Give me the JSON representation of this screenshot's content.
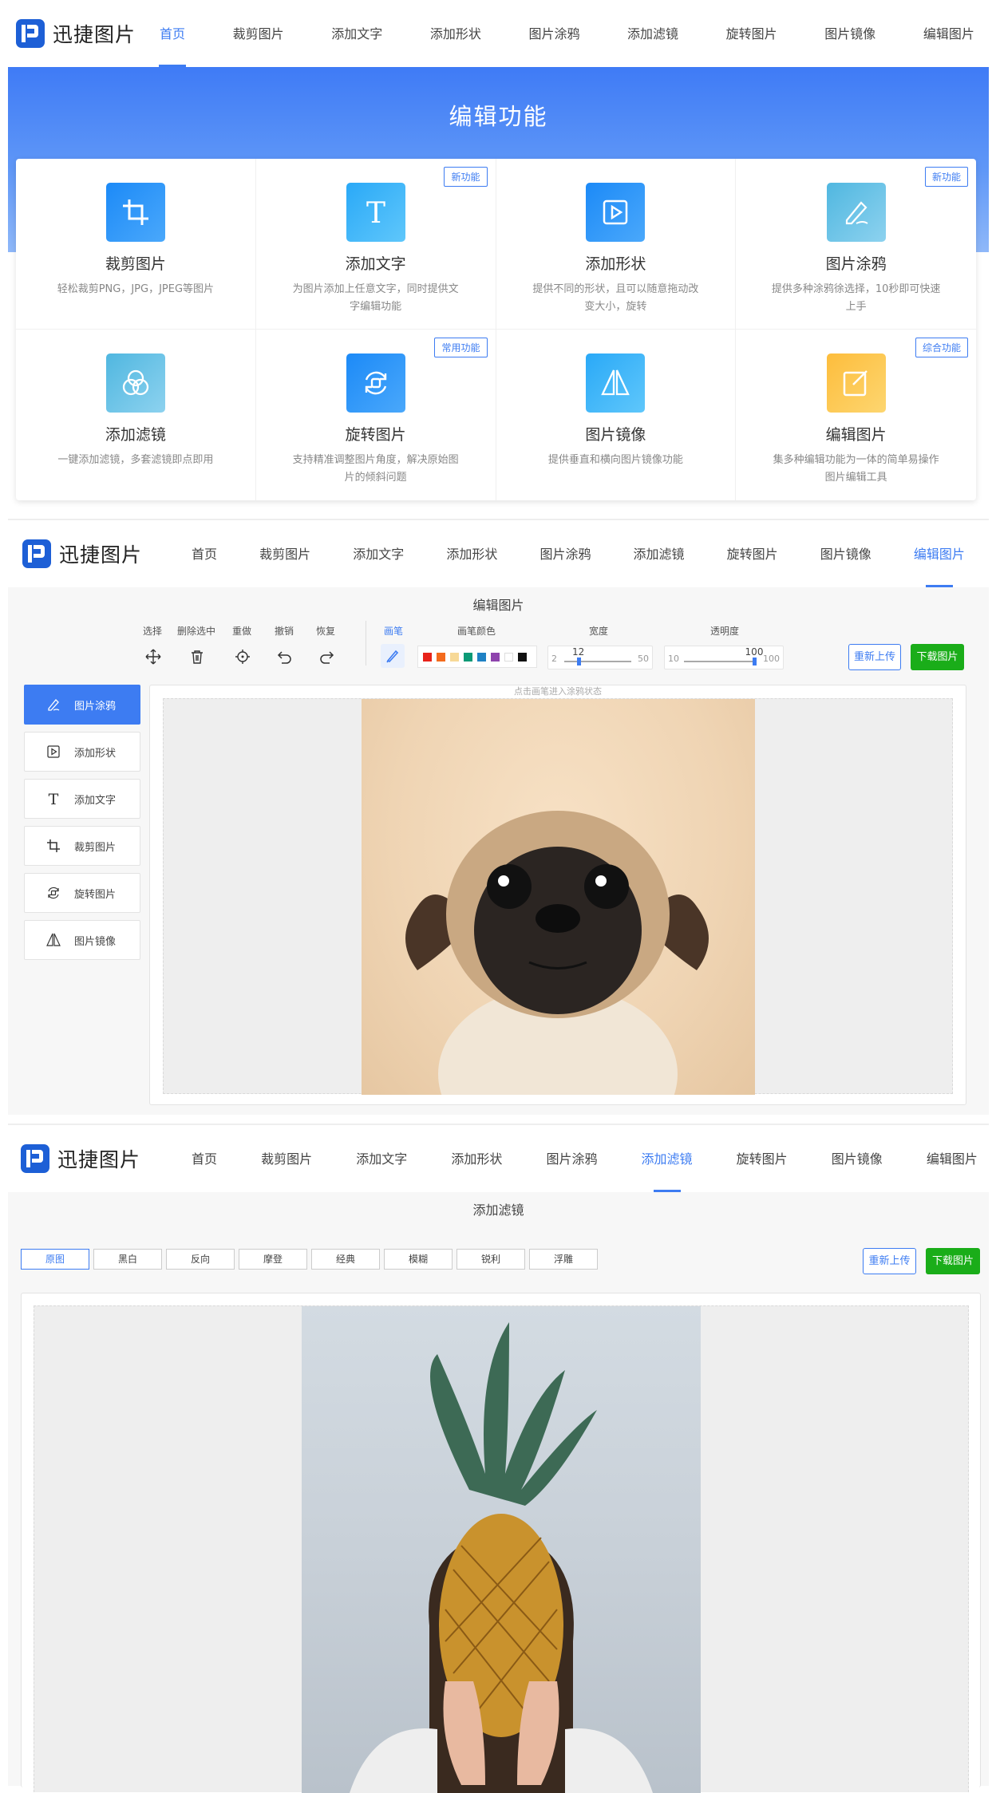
{
  "brand": {
    "name": "迅捷图片",
    "accent": "#3d7cf2",
    "green": "#1aad19"
  },
  "nav_items": [
    "首页",
    "裁剪图片",
    "添加文字",
    "添加形状",
    "图片涂鸦",
    "添加滤镜",
    "旋转图片",
    "图片镜像",
    "编辑图片"
  ],
  "panel1": {
    "active_nav": "首页",
    "hero_title": "编辑功能",
    "cards": [
      {
        "icon": "crop-icon",
        "title": "裁剪图片",
        "desc": "轻松裁剪PNG，JPG，JPEG等图片",
        "badge": ""
      },
      {
        "icon": "text-icon",
        "title": "添加文字",
        "desc": "为图片添加上任意文字，同时提供文字编辑功能",
        "badge": "新功能"
      },
      {
        "icon": "shape-icon",
        "title": "添加形状",
        "desc": "提供不同的形状，且可以随意拖动改变大小，旋转",
        "badge": ""
      },
      {
        "icon": "brush-icon",
        "title": "图片涂鸦",
        "desc": "提供多种涂鸦徐选择，10秒即可快速上手",
        "badge": "新功能"
      },
      {
        "icon": "filter-icon",
        "title": "添加滤镜",
        "desc": "一键添加滤镜，多套滤镜即点即用",
        "badge": ""
      },
      {
        "icon": "rotate-icon",
        "title": "旋转图片",
        "desc": "支持精准调整图片角度，解决原始图片的倾斜问题",
        "badge": "常用功能"
      },
      {
        "icon": "mirror-icon",
        "title": "图片镜像",
        "desc": "提供垂直和横向图片镜像功能",
        "badge": ""
      },
      {
        "icon": "edit-icon",
        "title": "编辑图片",
        "desc": "集多种编辑功能为一体的简单易操作图片编辑工具",
        "badge": "综合功能"
      }
    ]
  },
  "panel2": {
    "active_nav": "编辑图片",
    "title": "编辑图片",
    "tools": [
      {
        "label": "选择",
        "icon": "move-icon"
      },
      {
        "label": "删除选中",
        "icon": "trash-icon"
      },
      {
        "label": "重做",
        "icon": "target-icon"
      },
      {
        "label": "撤销",
        "icon": "undo-icon"
      },
      {
        "label": "恢复",
        "icon": "redo-icon"
      }
    ],
    "brush_label": "画笔",
    "brush_color_label": "画笔颜色",
    "colors": [
      "#e8231a",
      "#f46b1d",
      "#f7d997",
      "#0c9a76",
      "#1f81c4",
      "#8e44ad",
      "#ffffff",
      "#111111"
    ],
    "width": {
      "label": "宽度",
      "min": "2",
      "max": "50",
      "value": "12",
      "fraction": 0.21
    },
    "opacity": {
      "label": "透明度",
      "min": "10",
      "max": "100",
      "value": "100",
      "fraction": 1.0
    },
    "reupload": "重新上传",
    "download": "下载图片",
    "hint": "点击画笔进入涂鸦状态",
    "sidebar": [
      {
        "icon": "pen-icon",
        "label": "图片涂鸦",
        "active": true
      },
      {
        "icon": "shape-icon",
        "label": "添加形状",
        "active": false
      },
      {
        "icon": "text-icon",
        "label": "添加文字",
        "active": false
      },
      {
        "icon": "crop-icon",
        "label": "裁剪图片",
        "active": false
      },
      {
        "icon": "rotate-icon",
        "label": "旋转图片",
        "active": false
      },
      {
        "icon": "mirror-icon",
        "label": "图片镜像",
        "active": false
      }
    ]
  },
  "panel3": {
    "active_nav": "添加滤镜",
    "title": "添加滤镜",
    "filters": [
      "原图",
      "黑白",
      "反向",
      "摩登",
      "经典",
      "模糊",
      "锐利",
      "浮雕"
    ],
    "active_filter": "原图",
    "reupload": "重新上传",
    "download": "下载图片"
  }
}
